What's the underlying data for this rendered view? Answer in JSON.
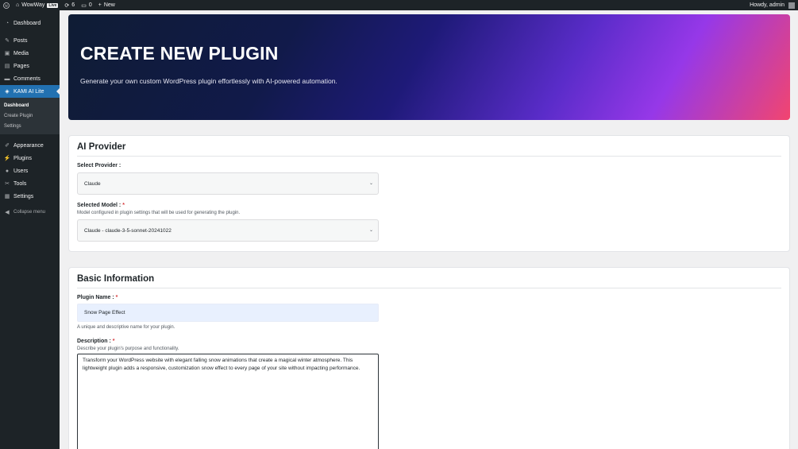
{
  "adminbar": {
    "site_name": "WowWay",
    "live_badge": "Live",
    "updates_count": "6",
    "comments_count": "0",
    "new_label": "New",
    "howdy": "Howdy, admin"
  },
  "sidebar": {
    "items": [
      {
        "label": "Dashboard",
        "icon": "dashboard-icon"
      },
      {
        "label": "Posts",
        "icon": "pin-icon"
      },
      {
        "label": "Media",
        "icon": "media-icon"
      },
      {
        "label": "Pages",
        "icon": "pages-icon"
      },
      {
        "label": "Comments",
        "icon": "comment-icon"
      },
      {
        "label": "KAMI AI Lite",
        "icon": "shield-icon"
      }
    ],
    "submenu": [
      "Dashboard",
      "Create Plugin",
      "Settings"
    ],
    "items2": [
      {
        "label": "Appearance",
        "icon": "brush-icon"
      },
      {
        "label": "Plugins",
        "icon": "plug-icon"
      },
      {
        "label": "Users",
        "icon": "user-icon"
      },
      {
        "label": "Tools",
        "icon": "wrench-icon"
      },
      {
        "label": "Settings",
        "icon": "settings-icon"
      }
    ],
    "collapse_label": "Collapse menu"
  },
  "hero": {
    "title": "CREATE NEW PLUGIN",
    "subtitle": "Generate your own custom WordPress plugin effortlessly with AI-powered automation."
  },
  "ai_provider": {
    "heading": "AI Provider",
    "provider_label": "Select Provider :",
    "provider_value": "Claude",
    "model_label": "Selected Model :",
    "required_mark": "*",
    "model_help": "Model configured in plugin settings that will be used for generating the plugin.",
    "model_value": "Claude - claude-3-5-sonnet-20241022"
  },
  "basic_info": {
    "heading": "Basic Information",
    "name_label": "Plugin Name :",
    "required_mark": "*",
    "name_value": "Snow Page Effect",
    "name_help": "A unique and descriptive name for your plugin.",
    "desc_label": "Description :",
    "desc_help": "Describe your plugin's purpose and functionality.",
    "desc_value": "Transform your WordPress website with elegant falling snow animations that create a magical winter atmosphere. This lightweight plugin adds a responsive, customization snow effect to every page of your site without impacting performance."
  }
}
